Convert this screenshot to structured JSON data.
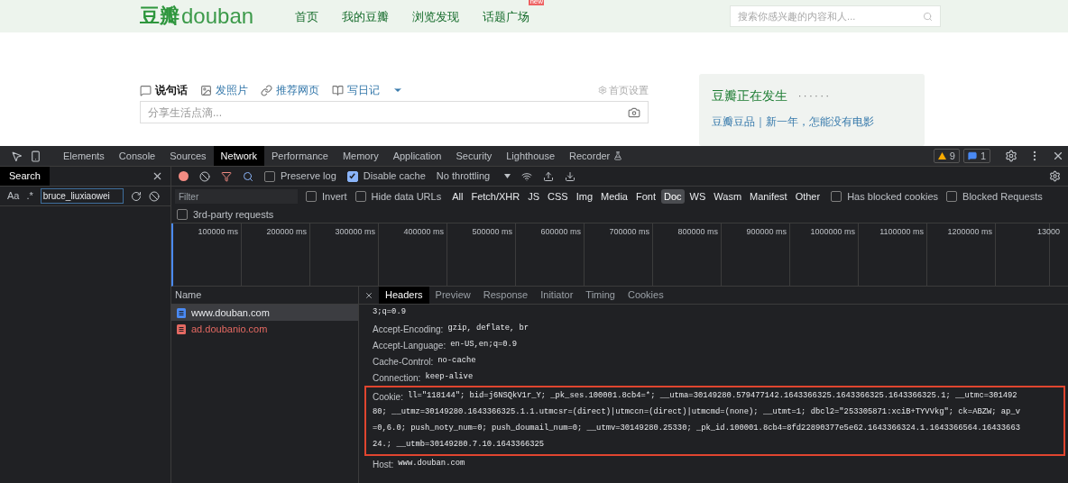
{
  "site": {
    "logo_cn": "豆瓣",
    "logo_en": "douban",
    "nav": [
      {
        "label": "首页"
      },
      {
        "label": "我的豆瓣"
      },
      {
        "label": "浏览发现"
      },
      {
        "label": "话题广场",
        "badge": "new"
      }
    ],
    "search": {
      "placeholder": "搜索你感兴趣的内容和人..."
    },
    "post_tabs": [
      {
        "label": "说句话",
        "selected": true
      },
      {
        "label": "发照片",
        "selected": false
      },
      {
        "label": "推荐网页",
        "selected": false
      },
      {
        "label": "写日记",
        "selected": false
      }
    ],
    "settings_link": "首页设置",
    "post_field": {
      "placeholder": "分享生活点滴..."
    },
    "side_card": {
      "title": "豆瓣正在发生",
      "dots": "· · · · · ·",
      "link": "豆瓣豆品｜新一年，怎能没有电影"
    }
  },
  "devtools": {
    "tabs": [
      {
        "label": "Elements",
        "selected": false
      },
      {
        "label": "Console",
        "selected": false
      },
      {
        "label": "Sources",
        "selected": false
      },
      {
        "label": "Network",
        "selected": true
      },
      {
        "label": "Performance",
        "selected": false
      },
      {
        "label": "Memory",
        "selected": false
      },
      {
        "label": "Application",
        "selected": false
      },
      {
        "label": "Security",
        "selected": false
      },
      {
        "label": "Lighthouse",
        "selected": false
      },
      {
        "label": "Recorder",
        "selected": false
      }
    ],
    "warnings": "9",
    "messages": "1",
    "search_panel": {
      "title": "Search",
      "case_label": "Aa",
      "regex_label": ".*",
      "query": "bruce_liuxiaowei"
    },
    "toolbar": {
      "recording": true,
      "preserve_log": {
        "label": "Preserve log",
        "checked": false
      },
      "disable_cache": {
        "label": "Disable cache",
        "checked": true
      },
      "throttling": "No throttling"
    },
    "filter": {
      "placeholder": "Filter",
      "invert": {
        "label": "Invert",
        "checked": false
      },
      "hide_data_urls": {
        "label": "Hide data URLs",
        "checked": false
      },
      "types": [
        {
          "label": "All",
          "selected": false
        },
        {
          "label": "Fetch/XHR",
          "selected": false
        },
        {
          "label": "JS",
          "selected": false
        },
        {
          "label": "CSS",
          "selected": false
        },
        {
          "label": "Img",
          "selected": false
        },
        {
          "label": "Media",
          "selected": false
        },
        {
          "label": "Font",
          "selected": false
        },
        {
          "label": "Doc",
          "selected": true
        },
        {
          "label": "WS",
          "selected": false
        },
        {
          "label": "Wasm",
          "selected": false
        },
        {
          "label": "Manifest",
          "selected": false
        },
        {
          "label": "Other",
          "selected": false
        }
      ],
      "blocked_cookies": {
        "label": "Has blocked cookies",
        "checked": false
      },
      "blocked_requests": {
        "label": "Blocked Requests",
        "checked": false
      },
      "third_party": {
        "label": "3rd-party requests",
        "checked": false
      }
    },
    "timeline_ticks": [
      "100000 ms",
      "200000 ms",
      "300000 ms",
      "400000 ms",
      "500000 ms",
      "600000 ms",
      "700000 ms",
      "800000 ms",
      "900000 ms",
      "1000000 ms",
      "1100000 ms",
      "1200000 ms",
      "13000"
    ],
    "name_column": "Name",
    "requests": [
      {
        "name": "www.douban.com",
        "selected": true,
        "color": "#4a8af4"
      },
      {
        "name": "ad.doubanio.com",
        "selected": false,
        "color": "#e46962"
      }
    ],
    "detail_tabs": [
      {
        "label": "Headers",
        "selected": true
      },
      {
        "label": "Preview",
        "selected": false
      },
      {
        "label": "Response",
        "selected": false
      },
      {
        "label": "Initiator",
        "selected": false
      },
      {
        "label": "Timing",
        "selected": false
      },
      {
        "label": "Cookies",
        "selected": false
      }
    ],
    "headers": [
      {
        "value_lines": [
          "3;q=0.9"
        ],
        "highlighted": false
      },
      {
        "name": "Accept-Encoding:",
        "value_lines": [
          "gzip, deflate, br"
        ],
        "highlighted": false
      },
      {
        "name": "Accept-Language:",
        "value_lines": [
          "en-US,en;q=0.9"
        ],
        "highlighted": false
      },
      {
        "name": "Cache-Control:",
        "value_lines": [
          "no-cache"
        ],
        "highlighted": false
      },
      {
        "name": "Connection:",
        "value_lines": [
          "keep-alive"
        ],
        "highlighted": false
      },
      {
        "name": "Cookie:",
        "value_lines": [
          "ll=\"118144\"; bid=j6NSQkV1r_Y; _pk_ses.100001.8cb4=*; __utma=30149280.579477142.1643366325.1643366325.1643366325.1; __utmc=301492",
          "80; __utmz=30149280.1643366325.1.1.utmcsr=(direct)|utmccn=(direct)|utmcmd=(none); __utmt=1; dbcl2=\"253305871:xciB+TYVVkg\"; ck=ABZW; ap_v",
          "=0,6.0; push_noty_num=0; push_doumail_num=0; __utmv=30149280.25330; _pk_id.100001.8cb4=8fd22890377e5e62.1643366324.1.1643366564.16433663",
          "24.; __utmb=30149280.7.10.1643366325"
        ],
        "highlighted": true
      },
      {
        "name": "Host:",
        "value_lines": [
          "www.douban.com"
        ],
        "highlighted": false
      }
    ]
  }
}
